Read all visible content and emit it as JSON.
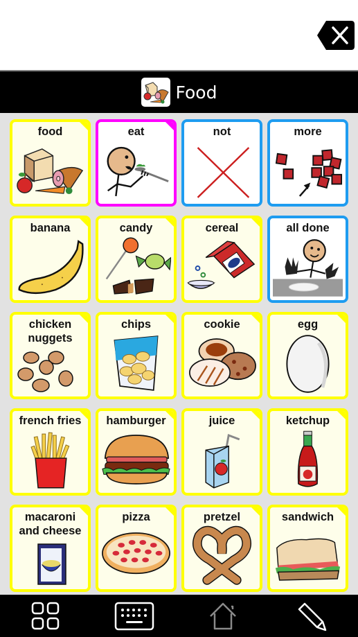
{
  "message_bar": {
    "text": "",
    "backspace_icon": "backspace-icon"
  },
  "board": {
    "title": "Food",
    "title_icon": "food-symbol-icon"
  },
  "cells": [
    {
      "label": "food",
      "type": "folder",
      "symbol": "food-icon"
    },
    {
      "label": "eat",
      "type": "verb",
      "symbol": "eat-icon"
    },
    {
      "label": "not",
      "type": "core",
      "symbol": "not-icon"
    },
    {
      "label": "more",
      "type": "core",
      "symbol": "more-icon"
    },
    {
      "label": "banana",
      "type": "folder",
      "symbol": "banana-icon"
    },
    {
      "label": "candy",
      "type": "folder",
      "symbol": "candy-icon"
    },
    {
      "label": "cereal",
      "type": "folder",
      "symbol": "cereal-icon"
    },
    {
      "label": "all done",
      "type": "core",
      "symbol": "all-done-icon"
    },
    {
      "label": "chicken nuggets",
      "type": "folder",
      "symbol": "chicken-nuggets-icon"
    },
    {
      "label": "chips",
      "type": "folder",
      "symbol": "chips-icon"
    },
    {
      "label": "cookie",
      "type": "folder",
      "symbol": "cookie-icon"
    },
    {
      "label": "egg",
      "type": "folder",
      "symbol": "egg-icon"
    },
    {
      "label": "french fries",
      "type": "folder",
      "symbol": "french-fries-icon"
    },
    {
      "label": "hamburger",
      "type": "folder",
      "symbol": "hamburger-icon"
    },
    {
      "label": "juice",
      "type": "folder",
      "symbol": "juice-icon"
    },
    {
      "label": "ketchup",
      "type": "folder",
      "symbol": "ketchup-icon"
    },
    {
      "label": "macaroni and cheese",
      "type": "folder",
      "symbol": "macaroni-icon"
    },
    {
      "label": "pizza",
      "type": "folder",
      "symbol": "pizza-icon"
    },
    {
      "label": "pretzel",
      "type": "folder",
      "symbol": "pretzel-icon"
    },
    {
      "label": "sandwich",
      "type": "folder",
      "symbol": "sandwich-icon"
    }
  ],
  "colors": {
    "folder_border": "#ffff00",
    "verb_border": "#ff00ff",
    "core_border": "#1e9cf0",
    "grid_background": "#e2e2e2",
    "bar_background": "#000000"
  },
  "toolbar": {
    "buttons": [
      {
        "name": "boards-button",
        "icon": "grid-icon"
      },
      {
        "name": "keyboard-button",
        "icon": "keyboard-icon"
      },
      {
        "name": "home-button",
        "icon": "home-icon"
      },
      {
        "name": "edit-button",
        "icon": "pencil-icon"
      }
    ]
  }
}
